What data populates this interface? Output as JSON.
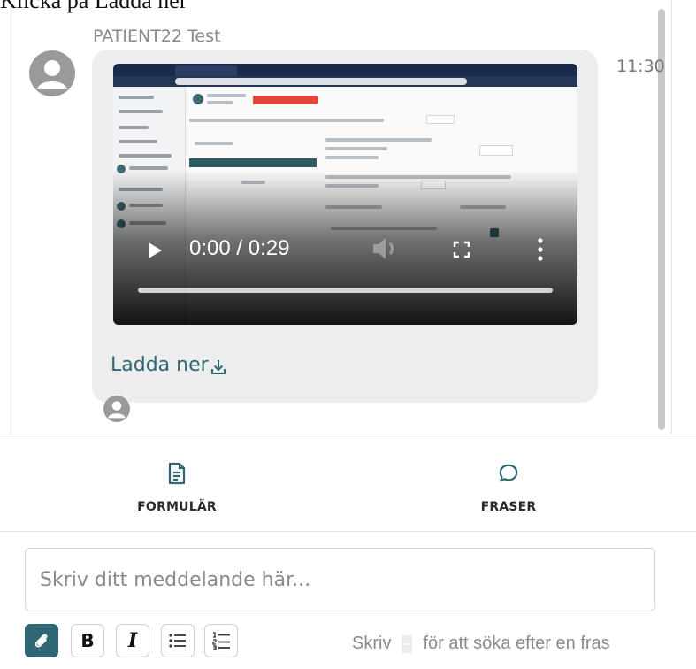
{
  "caption": "Klicka på Ladda ner",
  "message": {
    "sender": "PATIENT22 Test",
    "time": "11:30",
    "video": {
      "current_time": "0:00",
      "duration": "0:29",
      "time_display": "0:00 / 0:29",
      "progress": 0
    },
    "download_label": "Ladda ner"
  },
  "actions": {
    "form_label": "FORMULÄR",
    "phrases_label": "FRASER"
  },
  "composer": {
    "placeholder": "Skriv ditt meddelande här...",
    "value": "",
    "hint_before": "Skriv",
    "hint_after": "för att söka efter en fras"
  },
  "formatting": {
    "bold": "B",
    "italic": "I"
  },
  "colors": {
    "accent": "#2e6773",
    "bubble": "#ededed",
    "muted_text": "#888888"
  },
  "icons": [
    "user-avatar-icon",
    "play-icon",
    "volume-icon",
    "fullscreen-icon",
    "more-vertical-icon",
    "download-icon",
    "document-icon",
    "chat-bubble-icon",
    "paperclip-icon",
    "bulleted-list-icon",
    "numbered-list-icon"
  ]
}
